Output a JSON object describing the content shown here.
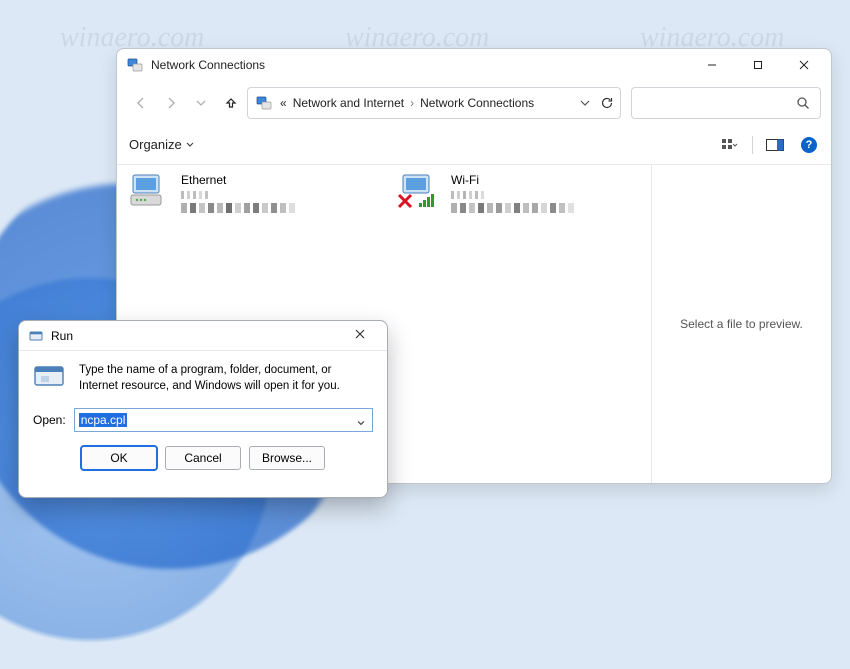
{
  "watermark": "winaero.com",
  "explorer": {
    "title": "Network Connections",
    "crumbs": {
      "prefix": "«",
      "a": "Network and Internet",
      "sep": "›",
      "b": "Network Connections"
    },
    "organize_label": "Organize",
    "preview_msg": "Select a file to preview.",
    "connections": [
      {
        "name": "Ethernet",
        "has_x": false
      },
      {
        "name": "Wi-Fi",
        "has_x": true
      }
    ]
  },
  "run": {
    "title": "Run",
    "description": "Type the name of a program, folder, document, or Internet resource, and Windows will open it for you.",
    "open_label": "Open:",
    "value": "ncpa.cpl",
    "buttons": {
      "ok": "OK",
      "cancel": "Cancel",
      "browse": "Browse..."
    }
  }
}
